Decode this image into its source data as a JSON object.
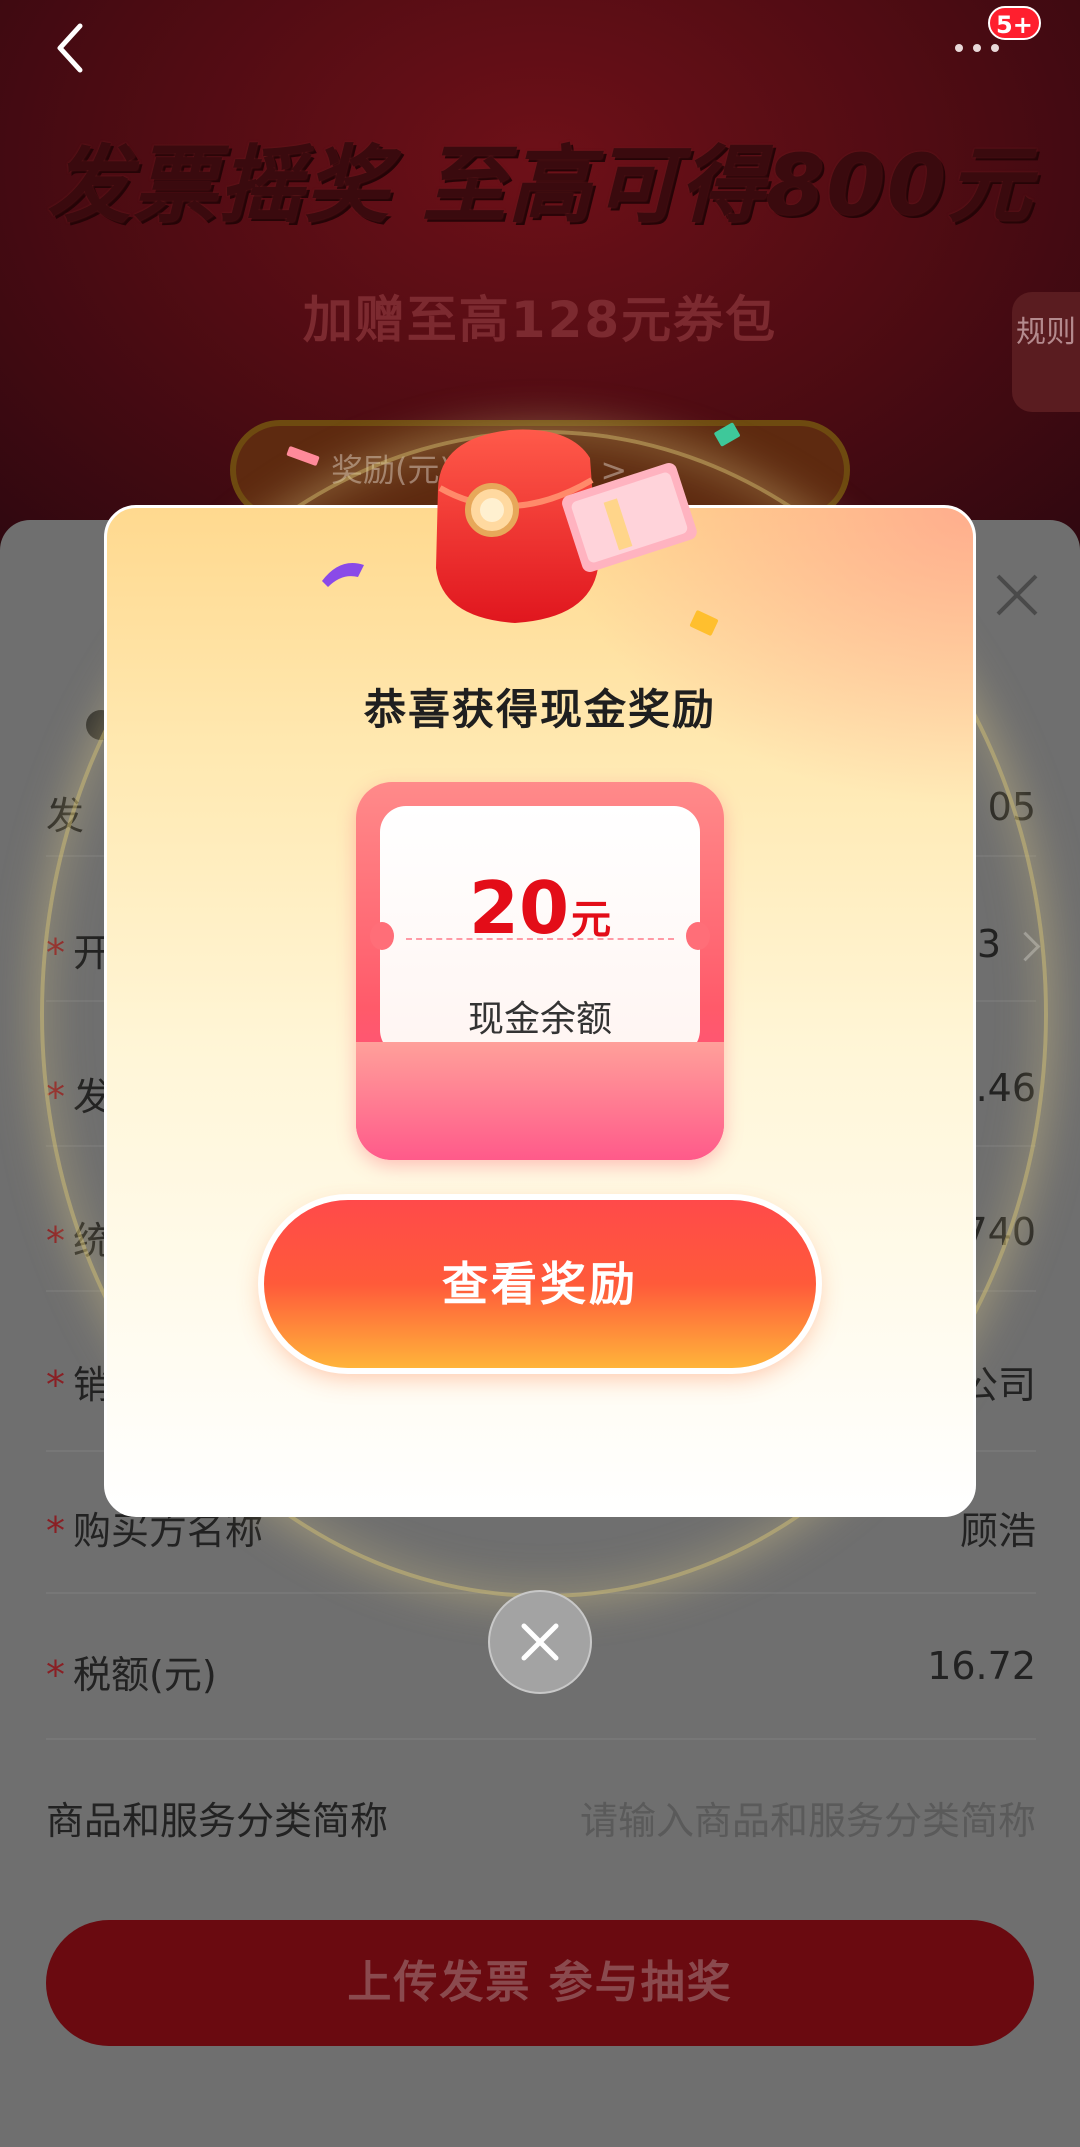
{
  "header": {
    "back_icon": "chevron-left-icon",
    "more_icon": "ellipsis-icon",
    "badge": "5+"
  },
  "hero": {
    "title": "发票摇奖 至高可得800元",
    "subtitle": "加赠至高128元券包",
    "rules_tab": "规则",
    "record_pill": "奖励(元)      报名记录 >"
  },
  "form": {
    "rows": [
      {
        "label": "发",
        "value": "05",
        "required": false
      },
      {
        "label": "开",
        "value": "3",
        "required": true
      },
      {
        "label": "发",
        "value": ".46",
        "required": true
      },
      {
        "label": "统",
        "value": "740",
        "required": true
      },
      {
        "label": "销",
        "value": "公司",
        "required": true
      },
      {
        "label": "购买方名称",
        "value": "顾浩",
        "required": true
      },
      {
        "label": "税额(元)",
        "value": "16.72",
        "required": true
      },
      {
        "label": "商品和服务分类简称",
        "placeholder": "请输入商品和服务分类简称",
        "required": false
      }
    ],
    "required_mark": "*"
  },
  "upload_button": "上传发票 参与抽奖",
  "modal": {
    "title": "恭喜获得现金奖励",
    "amount": "20",
    "unit": "元",
    "caption": "现金余额",
    "cta": "查看奖励",
    "close_icon": "close-icon",
    "gift_icon": "red-envelope-gift-icon"
  },
  "colors": {
    "primary_red": "#e30d18",
    "cta_top": "#ff4a4a",
    "cta_bottom": "#ffb43a"
  }
}
